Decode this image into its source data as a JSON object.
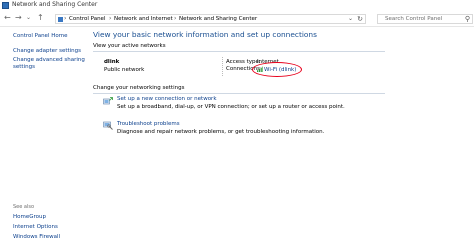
{
  "window": {
    "title": "Network and Sharing Center"
  },
  "address_bar": {
    "crumbs": [
      "Control Panel",
      "Network and Internet",
      "Network and Sharing Center"
    ]
  },
  "search": {
    "placeholder": "Search Control Panel"
  },
  "left_nav": {
    "links": [
      "Control Panel Home",
      "Change adapter settings",
      "Change advanced sharing",
      "settings"
    ],
    "see_also_heading": "See also",
    "see_also": [
      "HomeGroup",
      "Internet Options",
      "Windows Firewall"
    ]
  },
  "main": {
    "title": "View your basic network information and set up connections",
    "active_networks_heading": "View your active networks",
    "network": {
      "name": "dlink",
      "type": "Public network",
      "access_type_label": "Access type:",
      "access_type_value": "Internet",
      "connections_label": "Connections:",
      "connection_value": "Wi-Fi (dlink)"
    },
    "change_settings_heading": "Change your networking settings",
    "tasks": [
      {
        "link": "Set up a new connection or network",
        "desc": "Set up a broadband, dial-up, or VPN connection; or set up a router or access point."
      },
      {
        "link": "Troubleshoot problems",
        "desc": "Diagnose and repair network problems, or get troubleshooting information."
      }
    ]
  },
  "colors": {
    "link": "#0b3f8c",
    "title": "#1a4f91",
    "highlight": "#e8001c"
  }
}
